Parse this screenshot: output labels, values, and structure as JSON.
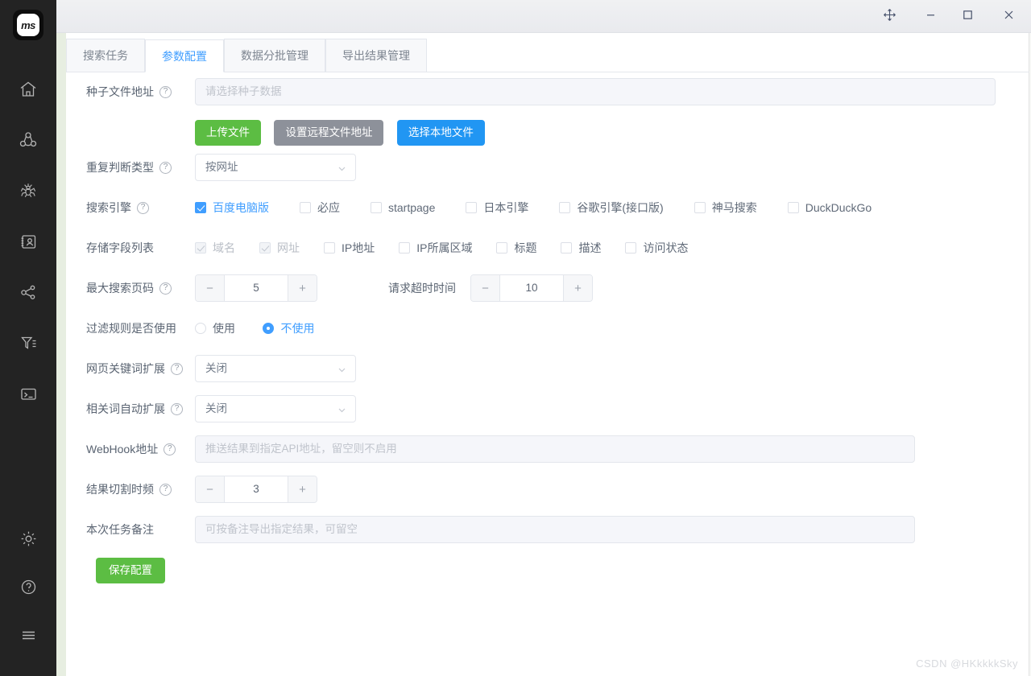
{
  "window": {
    "logo_text": "ms",
    "controls": [
      {
        "name": "move-window-button",
        "glyph": "move"
      },
      {
        "name": "minimize-button",
        "glyph": "minimize"
      },
      {
        "name": "maximize-button",
        "glyph": "maximize"
      },
      {
        "name": "close-button",
        "glyph": "close"
      }
    ]
  },
  "sidebar": {
    "items": [
      {
        "icon": "home-icon",
        "label": "home"
      },
      {
        "icon": "share-network-icon",
        "label": "network"
      },
      {
        "icon": "spider-icon",
        "label": "spider"
      },
      {
        "icon": "contact-card-icon",
        "label": "contacts"
      },
      {
        "icon": "share-nodes-icon",
        "label": "share"
      },
      {
        "icon": "filter-icon",
        "label": "filter"
      },
      {
        "icon": "terminal-icon",
        "label": "terminal"
      }
    ],
    "bottom": [
      {
        "icon": "gear-icon",
        "label": "settings"
      },
      {
        "icon": "question-circle-icon",
        "label": "help"
      },
      {
        "icon": "hamburger-icon",
        "label": "menu"
      }
    ]
  },
  "tabs": [
    {
      "label": "搜索任务",
      "active": false
    },
    {
      "label": "参数配置",
      "active": true
    },
    {
      "label": "数据分批管理",
      "active": false
    },
    {
      "label": "导出结果管理",
      "active": false
    }
  ],
  "form": {
    "seed_file": {
      "label": "种子文件地址",
      "has_help": true,
      "placeholder": "请选择种子数据",
      "value": "",
      "buttons": [
        {
          "label": "上传文件",
          "style": "green"
        },
        {
          "label": "设置远程文件地址",
          "style": "gray"
        },
        {
          "label": "选择本地文件",
          "style": "blue"
        }
      ]
    },
    "dedup_type": {
      "label": "重复判断类型",
      "has_help": true,
      "value": "按网址"
    },
    "search_engine": {
      "label": "搜索引擎",
      "has_help": true,
      "options": [
        {
          "label": "百度电脑版",
          "checked": true,
          "disabled": false
        },
        {
          "label": "必应",
          "checked": false,
          "disabled": false
        },
        {
          "label": "startpage",
          "checked": false,
          "disabled": false
        },
        {
          "label": "日本引擎",
          "checked": false,
          "disabled": false
        },
        {
          "label": "谷歌引擎(接口版)",
          "checked": false,
          "disabled": false
        },
        {
          "label": "神马搜索",
          "checked": false,
          "disabled": false
        },
        {
          "label": "DuckDuckGo",
          "checked": false,
          "disabled": false
        }
      ]
    },
    "store_fields": {
      "label": "存储字段列表",
      "has_help": false,
      "options": [
        {
          "label": "域名",
          "checked": true,
          "disabled": true
        },
        {
          "label": "网址",
          "checked": true,
          "disabled": true
        },
        {
          "label": "IP地址",
          "checked": false,
          "disabled": false
        },
        {
          "label": "IP所属区域",
          "checked": false,
          "disabled": false
        },
        {
          "label": "标题",
          "checked": false,
          "disabled": false
        },
        {
          "label": "描述",
          "checked": false,
          "disabled": false
        },
        {
          "label": "访问状态",
          "checked": false,
          "disabled": false
        }
      ]
    },
    "max_page": {
      "label": "最大搜索页码",
      "has_help": true,
      "value": "5",
      "minus": "−",
      "plus": "+"
    },
    "timeout": {
      "label": "请求超时时间",
      "value": "10",
      "minus": "−",
      "plus": "+"
    },
    "filter_rule": {
      "label": "过滤规则是否使用",
      "has_help": false,
      "options": [
        {
          "label": "使用",
          "checked": false
        },
        {
          "label": "不使用",
          "checked": true
        }
      ]
    },
    "keyword_expand": {
      "label": "网页关键词扩展",
      "has_help": true,
      "value": "关闭"
    },
    "related_expand": {
      "label": "相关词自动扩展",
      "has_help": true,
      "value": "关闭"
    },
    "webhook": {
      "label": "WebHook地址",
      "has_help": true,
      "placeholder": "推送结果到指定API地址，留空则不启用",
      "value": ""
    },
    "split_freq": {
      "label": "结果切割时频",
      "has_help": true,
      "value": "3",
      "minus": "−",
      "plus": "+"
    },
    "task_remark": {
      "label": "本次任务备注",
      "has_help": false,
      "placeholder": "可按备注导出指定结果，可留空",
      "value": ""
    },
    "save_button": {
      "label": "保存配置"
    }
  },
  "watermark": "CSDN @HKkkkkSky",
  "colors": {
    "accent_blue": "#409eff",
    "green": "#5cbd43",
    "gray_btn": "#8d919a",
    "blue_btn": "#2196f3",
    "rail_bg": "#232323"
  }
}
